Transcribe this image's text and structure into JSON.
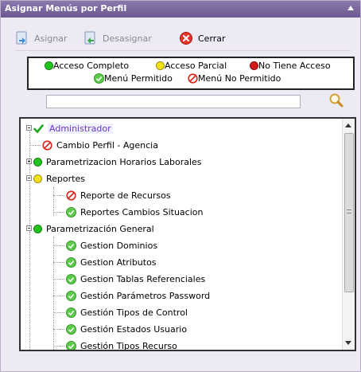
{
  "window": {
    "title": "Asignar Menús por Perfil"
  },
  "toolbar": {
    "assign_label": "Asignar",
    "unassign_label": "Desasignar",
    "close_label": "Cerrar"
  },
  "legend": {
    "full_access": "Acceso Completo",
    "partial_access": "Acceso Parcial",
    "no_access": "No Tiene Acceso",
    "menu_allowed": "Menú Permitido",
    "menu_not_allowed": "Menú No Permitido"
  },
  "search": {
    "value": "",
    "placeholder": ""
  },
  "tree": {
    "nodes": [
      {
        "label": "Administrador",
        "icon": "check-icon"
      },
      {
        "label": "Cambio Perfil - Agencia",
        "icon": "not-allowed-icon"
      },
      {
        "label": "Parametrizacion Horarios Laborales",
        "icon": "green-dot-icon"
      },
      {
        "label": "Reportes",
        "icon": "yellow-dot-icon"
      },
      {
        "label": "Reporte de Recursos",
        "icon": "not-allowed-icon"
      },
      {
        "label": "Reportes Cambios Situacion",
        "icon": "allowed-icon"
      },
      {
        "label": "Parametrización General",
        "icon": "green-dot-icon"
      },
      {
        "label": "Gestion Dominios",
        "icon": "allowed-icon"
      },
      {
        "label": "Gestion Atributos",
        "icon": "allowed-icon"
      },
      {
        "label": "Gestion Tablas Referenciales",
        "icon": "allowed-icon"
      },
      {
        "label": "Gestión Parámetros Password",
        "icon": "allowed-icon"
      },
      {
        "label": "Gestión Tipos de Control",
        "icon": "allowed-icon"
      },
      {
        "label": "Gestión Estados Usuario",
        "icon": "allowed-icon"
      },
      {
        "label": "Gestión Tipos Recurso",
        "icon": "allowed-icon"
      }
    ]
  },
  "colors": {
    "title_bar": "#6c5891",
    "full_access": "#22c51e",
    "partial_access": "#f2e21a",
    "no_access": "#d11a1a",
    "menu_allowed": "#5cc94a",
    "admin_label": "#6a38c7"
  }
}
